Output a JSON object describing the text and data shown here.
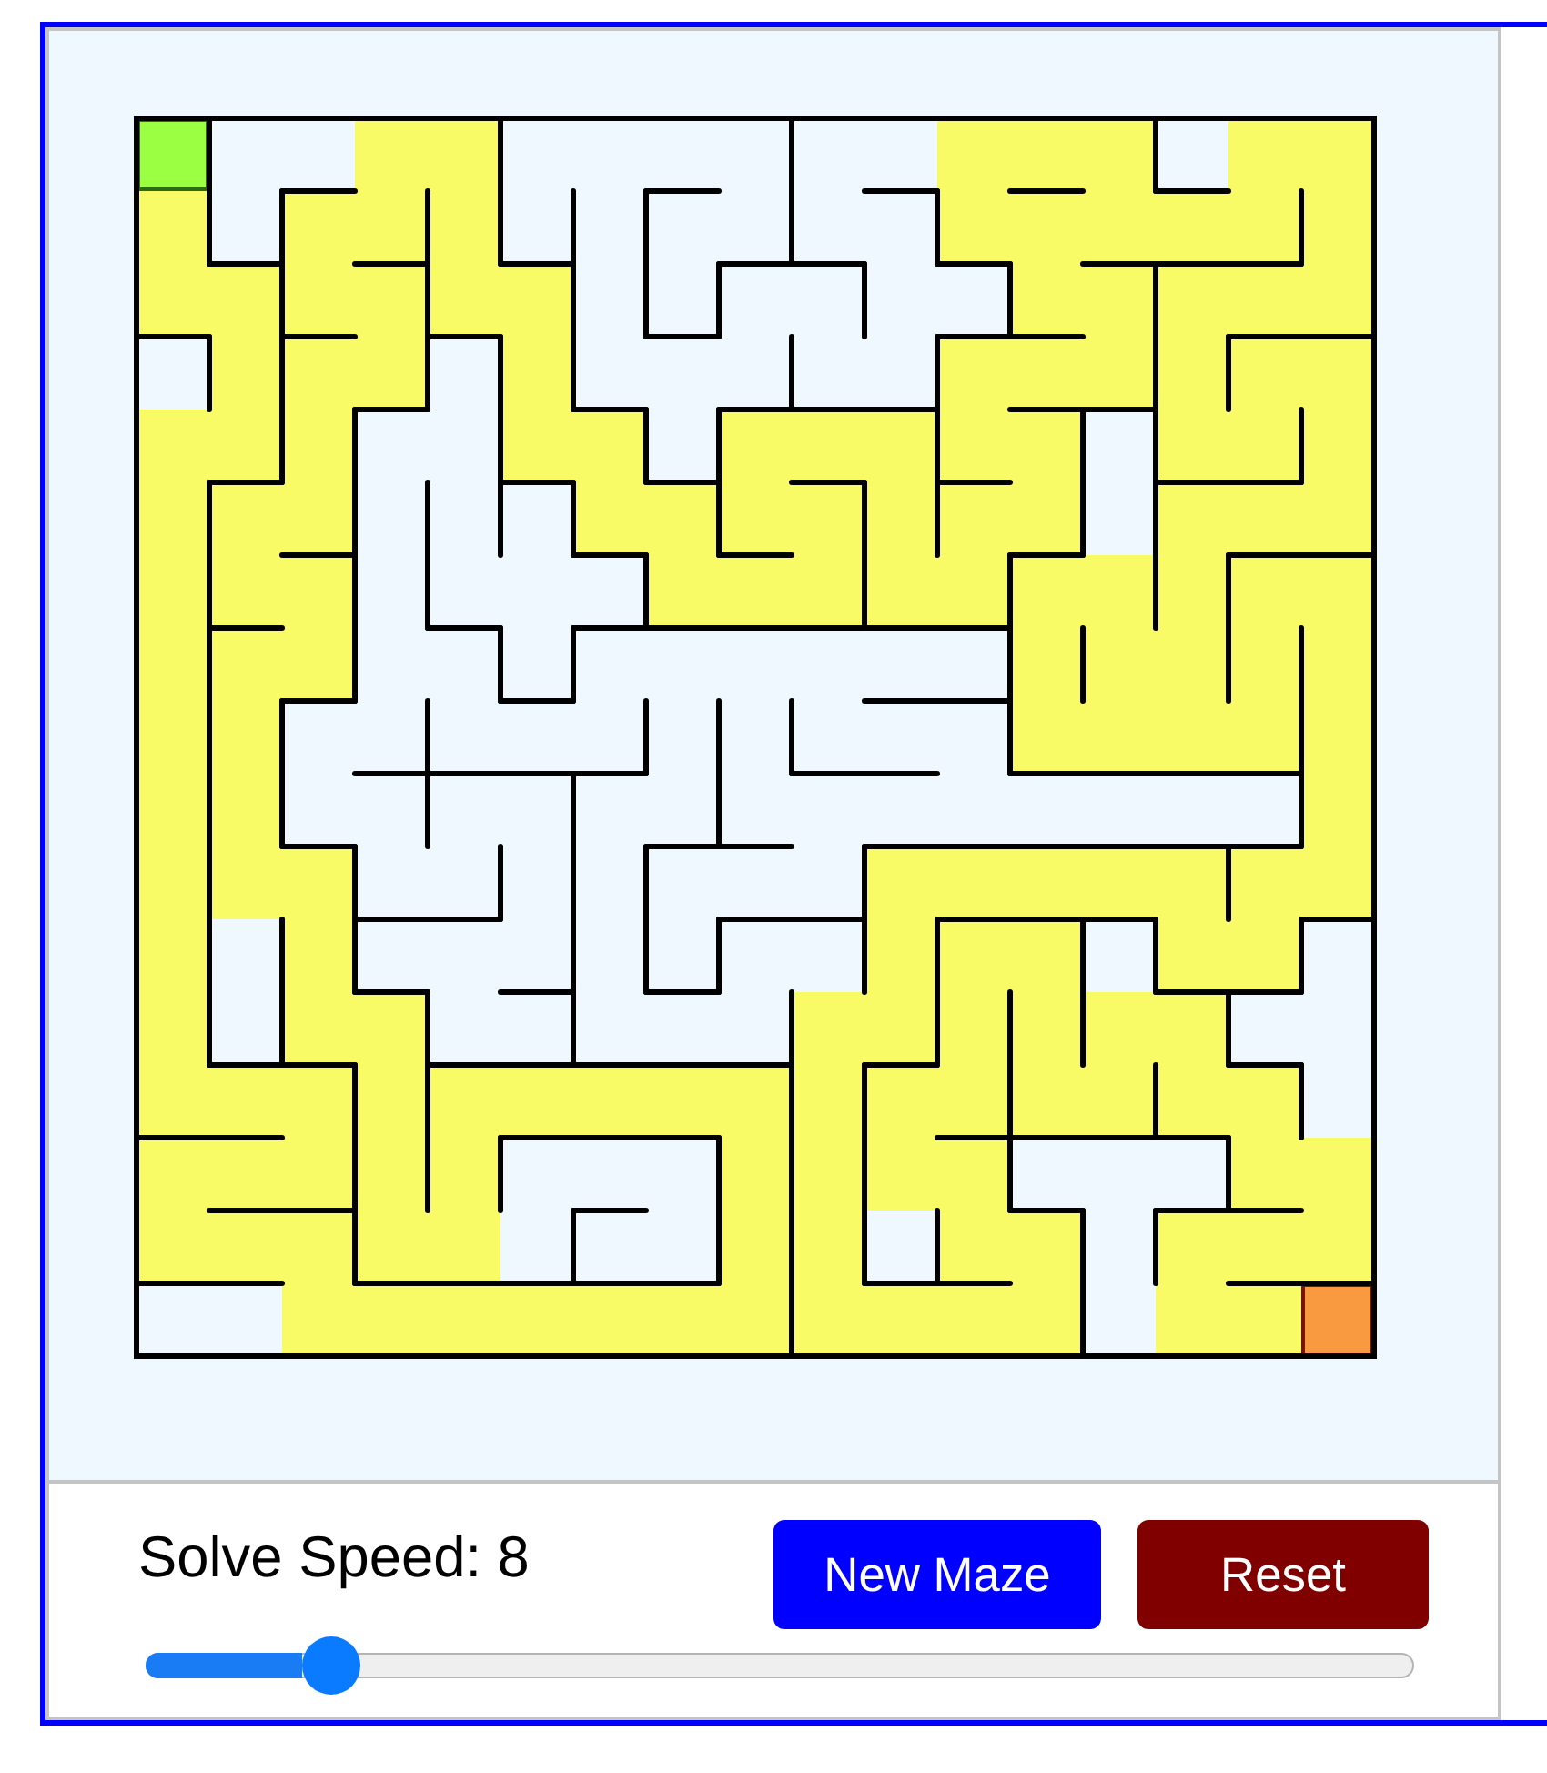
{
  "maze": {
    "cells": [
      [
        {
          "kind": "start",
          "right_wall": true
        },
        {
          "kind": "open"
        },
        {
          "kind": "open",
          "bottom_wall": true
        },
        {
          "kind": "path"
        },
        {
          "kind": "path",
          "right_wall": true
        },
        {
          "kind": "open"
        },
        {
          "kind": "open"
        },
        {
          "kind": "open",
          "bottom_wall": true
        },
        {
          "kind": "open",
          "right_wall": true
        },
        {
          "kind": "open"
        },
        {
          "kind": "open",
          "bottom_wall": true
        },
        {
          "kind": "path"
        },
        {
          "kind": "path",
          "bottom_wall": true
        },
        {
          "kind": "path",
          "right_wall": true
        },
        {
          "kind": "open",
          "bottom_wall": true
        },
        {
          "kind": "path"
        },
        {
          "kind": "path"
        }
      ],
      [
        {
          "kind": "path",
          "right_wall": true
        },
        {
          "kind": "open",
          "right_wall": true,
          "bottom_wall": true
        },
        {
          "kind": "path"
        },
        {
          "kind": "path",
          "right_wall": true,
          "bottom_wall": true
        },
        {
          "kind": "path",
          "right_wall": true
        },
        {
          "kind": "open",
          "right_wall": true,
          "bottom_wall": true
        },
        {
          "kind": "open",
          "right_wall": true
        },
        {
          "kind": "open"
        },
        {
          "kind": "open",
          "right_wall": true,
          "bottom_wall": true
        },
        {
          "kind": "open",
          "bottom_wall": true
        },
        {
          "kind": "open",
          "right_wall": true
        },
        {
          "kind": "path",
          "bottom_wall": true
        },
        {
          "kind": "path"
        },
        {
          "kind": "path",
          "bottom_wall": true
        },
        {
          "kind": "path",
          "bottom_wall": true
        },
        {
          "kind": "path",
          "right_wall": true,
          "bottom_wall": true
        },
        {
          "kind": "path"
        }
      ],
      [
        {
          "kind": "path",
          "bottom_wall": true
        },
        {
          "kind": "path",
          "right_wall": true
        },
        {
          "kind": "path",
          "bottom_wall": true
        },
        {
          "kind": "path",
          "right_wall": true
        },
        {
          "kind": "path",
          "bottom_wall": true
        },
        {
          "kind": "path",
          "right_wall": true
        },
        {
          "kind": "open",
          "right_wall": true
        },
        {
          "kind": "open",
          "right_wall": true,
          "bottom_wall": true
        },
        {
          "kind": "open"
        },
        {
          "kind": "open",
          "right_wall": true
        },
        {
          "kind": "open"
        },
        {
          "kind": "open",
          "right_wall": true,
          "bottom_wall": true
        },
        {
          "kind": "path",
          "bottom_wall": true
        },
        {
          "kind": "path",
          "right_wall": true
        },
        {
          "kind": "path"
        },
        {
          "kind": "path",
          "bottom_wall": true
        },
        {
          "kind": "path",
          "bottom_wall": true
        }
      ],
      [
        {
          "kind": "open",
          "right_wall": true
        },
        {
          "kind": "path",
          "right_wall": true
        },
        {
          "kind": "path"
        },
        {
          "kind": "path",
          "right_wall": true,
          "bottom_wall": true
        },
        {
          "kind": "open",
          "right_wall": true
        },
        {
          "kind": "path",
          "right_wall": true
        },
        {
          "kind": "open",
          "bottom_wall": true
        },
        {
          "kind": "open"
        },
        {
          "kind": "open",
          "right_wall": true,
          "bottom_wall": true
        },
        {
          "kind": "open",
          "bottom_wall": true
        },
        {
          "kind": "open",
          "right_wall": true,
          "bottom_wall": true
        },
        {
          "kind": "path"
        },
        {
          "kind": "path",
          "bottom_wall": true
        },
        {
          "kind": "path",
          "right_wall": true,
          "bottom_wall": true
        },
        {
          "kind": "path",
          "right_wall": true
        },
        {
          "kind": "path"
        },
        {
          "kind": "path"
        }
      ],
      [
        {
          "kind": "path"
        },
        {
          "kind": "path",
          "right_wall": true,
          "bottom_wall": true
        },
        {
          "kind": "path",
          "right_wall": true
        },
        {
          "kind": "open"
        },
        {
          "kind": "open",
          "right_wall": true
        },
        {
          "kind": "path",
          "bottom_wall": true
        },
        {
          "kind": "path",
          "right_wall": true
        },
        {
          "kind": "open",
          "right_wall": true,
          "bottom_wall": true
        },
        {
          "kind": "path"
        },
        {
          "kind": "path",
          "bottom_wall": true
        },
        {
          "kind": "path",
          "right_wall": true
        },
        {
          "kind": "path",
          "bottom_wall": true
        },
        {
          "kind": "path",
          "right_wall": true
        },
        {
          "kind": "open",
          "right_wall": true
        },
        {
          "kind": "path",
          "bottom_wall": true
        },
        {
          "kind": "path",
          "right_wall": true,
          "bottom_wall": true
        },
        {
          "kind": "path"
        }
      ],
      [
        {
          "kind": "path",
          "right_wall": true
        },
        {
          "kind": "path"
        },
        {
          "kind": "path",
          "right_wall": true,
          "bottom_wall": true
        },
        {
          "kind": "open",
          "right_wall": true
        },
        {
          "kind": "open",
          "right_wall": true
        },
        {
          "kind": "open",
          "right_wall": true
        },
        {
          "kind": "path",
          "bottom_wall": true
        },
        {
          "kind": "path",
          "right_wall": true
        },
        {
          "kind": "path",
          "bottom_wall": true
        },
        {
          "kind": "path",
          "right_wall": true
        },
        {
          "kind": "path",
          "right_wall": true
        },
        {
          "kind": "path"
        },
        {
          "kind": "path",
          "right_wall": true,
          "bottom_wall": true
        },
        {
          "kind": "open",
          "right_wall": true
        },
        {
          "kind": "path"
        },
        {
          "kind": "path",
          "bottom_wall": true
        },
        {
          "kind": "path",
          "bottom_wall": true
        }
      ],
      [
        {
          "kind": "path",
          "right_wall": true
        },
        {
          "kind": "path",
          "bottom_wall": true
        },
        {
          "kind": "path",
          "right_wall": true
        },
        {
          "kind": "open",
          "right_wall": true
        },
        {
          "kind": "open",
          "bottom_wall": true
        },
        {
          "kind": "open"
        },
        {
          "kind": "open",
          "right_wall": true,
          "bottom_wall": true
        },
        {
          "kind": "path",
          "bottom_wall": true
        },
        {
          "kind": "path",
          "bottom_wall": true
        },
        {
          "kind": "path",
          "right_wall": true,
          "bottom_wall": true
        },
        {
          "kind": "path",
          "bottom_wall": true
        },
        {
          "kind": "path",
          "right_wall": true,
          "bottom_wall": true
        },
        {
          "kind": "path"
        },
        {
          "kind": "path",
          "right_wall": true
        },
        {
          "kind": "path",
          "right_wall": true
        },
        {
          "kind": "path"
        },
        {
          "kind": "path"
        }
      ],
      [
        {
          "kind": "path",
          "right_wall": true
        },
        {
          "kind": "path"
        },
        {
          "kind": "path",
          "right_wall": true,
          "bottom_wall": true
        },
        {
          "kind": "open"
        },
        {
          "kind": "open",
          "right_wall": true
        },
        {
          "kind": "open",
          "right_wall": true,
          "bottom_wall": true
        },
        {
          "kind": "open"
        },
        {
          "kind": "open"
        },
        {
          "kind": "open"
        },
        {
          "kind": "open"
        },
        {
          "kind": "open",
          "bottom_wall": true
        },
        {
          "kind": "open",
          "right_wall": true,
          "bottom_wall": true
        },
        {
          "kind": "path",
          "right_wall": true
        },
        {
          "kind": "path"
        },
        {
          "kind": "path",
          "right_wall": true
        },
        {
          "kind": "path",
          "right_wall": true
        },
        {
          "kind": "path"
        }
      ],
      [
        {
          "kind": "path",
          "right_wall": true
        },
        {
          "kind": "path",
          "right_wall": true
        },
        {
          "kind": "open"
        },
        {
          "kind": "open",
          "right_wall": true,
          "bottom_wall": true
        },
        {
          "kind": "open",
          "bottom_wall": true
        },
        {
          "kind": "open",
          "bottom_wall": true
        },
        {
          "kind": "open",
          "right_wall": true,
          "bottom_wall": true
        },
        {
          "kind": "open",
          "right_wall": true
        },
        {
          "kind": "open",
          "right_wall": true
        },
        {
          "kind": "open",
          "bottom_wall": true
        },
        {
          "kind": "open",
          "bottom_wall": true
        },
        {
          "kind": "open",
          "right_wall": true
        },
        {
          "kind": "path",
          "bottom_wall": true
        },
        {
          "kind": "path",
          "bottom_wall": true
        },
        {
          "kind": "path",
          "bottom_wall": true
        },
        {
          "kind": "path",
          "right_wall": true,
          "bottom_wall": true
        },
        {
          "kind": "path"
        }
      ],
      [
        {
          "kind": "path",
          "right_wall": true
        },
        {
          "kind": "path",
          "right_wall": true
        },
        {
          "kind": "open",
          "bottom_wall": true
        },
        {
          "kind": "open",
          "right_wall": true
        },
        {
          "kind": "open"
        },
        {
          "kind": "open",
          "right_wall": true
        },
        {
          "kind": "open"
        },
        {
          "kind": "open",
          "right_wall": true,
          "bottom_wall": true
        },
        {
          "kind": "open",
          "bottom_wall": true
        },
        {
          "kind": "open"
        },
        {
          "kind": "open",
          "bottom_wall": true
        },
        {
          "kind": "open",
          "bottom_wall": true
        },
        {
          "kind": "open",
          "bottom_wall": true
        },
        {
          "kind": "open",
          "bottom_wall": true
        },
        {
          "kind": "open",
          "bottom_wall": true
        },
        {
          "kind": "open",
          "right_wall": true,
          "bottom_wall": true
        },
        {
          "kind": "path"
        }
      ],
      [
        {
          "kind": "path",
          "right_wall": true
        },
        {
          "kind": "path"
        },
        {
          "kind": "path",
          "right_wall": true
        },
        {
          "kind": "open",
          "bottom_wall": true
        },
        {
          "kind": "open",
          "right_wall": true,
          "bottom_wall": true
        },
        {
          "kind": "open",
          "right_wall": true
        },
        {
          "kind": "open",
          "right_wall": true
        },
        {
          "kind": "open"
        },
        {
          "kind": "open",
          "bottom_wall": true
        },
        {
          "kind": "open",
          "right_wall": true,
          "bottom_wall": true
        },
        {
          "kind": "path"
        },
        {
          "kind": "path",
          "bottom_wall": true
        },
        {
          "kind": "path",
          "bottom_wall": true
        },
        {
          "kind": "path",
          "bottom_wall": true
        },
        {
          "kind": "path",
          "right_wall": true
        },
        {
          "kind": "path"
        },
        {
          "kind": "path",
          "bottom_wall": true
        }
      ],
      [
        {
          "kind": "path",
          "right_wall": true
        },
        {
          "kind": "open",
          "right_wall": true
        },
        {
          "kind": "path",
          "right_wall": true
        },
        {
          "kind": "open",
          "bottom_wall": true
        },
        {
          "kind": "open"
        },
        {
          "kind": "open",
          "right_wall": true,
          "bottom_wall": true
        },
        {
          "kind": "open",
          "right_wall": true
        },
        {
          "kind": "open",
          "right_wall": true,
          "bottom_wall": true
        },
        {
          "kind": "open"
        },
        {
          "kind": "open",
          "right_wall": true
        },
        {
          "kind": "path",
          "right_wall": true
        },
        {
          "kind": "path"
        },
        {
          "kind": "path",
          "right_wall": true
        },
        {
          "kind": "open",
          "right_wall": true
        },
        {
          "kind": "path",
          "bottom_wall": true
        },
        {
          "kind": "path",
          "right_wall": true,
          "bottom_wall": true
        },
        {
          "kind": "open"
        }
      ],
      [
        {
          "kind": "path",
          "right_wall": true
        },
        {
          "kind": "open",
          "right_wall": true,
          "bottom_wall": true
        },
        {
          "kind": "path",
          "bottom_wall": true
        },
        {
          "kind": "path",
          "right_wall": true
        },
        {
          "kind": "open",
          "bottom_wall": true
        },
        {
          "kind": "open",
          "right_wall": true,
          "bottom_wall": true
        },
        {
          "kind": "open",
          "bottom_wall": true
        },
        {
          "kind": "open",
          "bottom_wall": true
        },
        {
          "kind": "open",
          "right_wall": true,
          "bottom_wall": true
        },
        {
          "kind": "path"
        },
        {
          "kind": "path",
          "right_wall": true,
          "bottom_wall": true
        },
        {
          "kind": "path",
          "right_wall": true
        },
        {
          "kind": "path",
          "right_wall": true
        },
        {
          "kind": "path"
        },
        {
          "kind": "path",
          "right_wall": true
        },
        {
          "kind": "open",
          "bottom_wall": true
        },
        {
          "kind": "open"
        }
      ],
      [
        {
          "kind": "path",
          "bottom_wall": true
        },
        {
          "kind": "path",
          "bottom_wall": true
        },
        {
          "kind": "path",
          "right_wall": true
        },
        {
          "kind": "path",
          "right_wall": true
        },
        {
          "kind": "path"
        },
        {
          "kind": "path",
          "bottom_wall": true
        },
        {
          "kind": "path",
          "bottom_wall": true
        },
        {
          "kind": "path",
          "bottom_wall": true
        },
        {
          "kind": "path",
          "right_wall": true
        },
        {
          "kind": "path",
          "right_wall": true
        },
        {
          "kind": "path"
        },
        {
          "kind": "path",
          "right_wall": true,
          "bottom_wall": true
        },
        {
          "kind": "path",
          "bottom_wall": true
        },
        {
          "kind": "path",
          "right_wall": true,
          "bottom_wall": true
        },
        {
          "kind": "path",
          "bottom_wall": true
        },
        {
          "kind": "path",
          "right_wall": true
        },
        {
          "kind": "open"
        }
      ],
      [
        {
          "kind": "path"
        },
        {
          "kind": "path",
          "bottom_wall": true
        },
        {
          "kind": "path",
          "right_wall": true,
          "bottom_wall": true
        },
        {
          "kind": "path",
          "right_wall": true
        },
        {
          "kind": "path",
          "right_wall": true
        },
        {
          "kind": "open"
        },
        {
          "kind": "open",
          "bottom_wall": true
        },
        {
          "kind": "open",
          "right_wall": true
        },
        {
          "kind": "path",
          "right_wall": true
        },
        {
          "kind": "path",
          "right_wall": true
        },
        {
          "kind": "path"
        },
        {
          "kind": "path",
          "right_wall": true
        },
        {
          "kind": "open",
          "bottom_wall": true
        },
        {
          "kind": "open"
        },
        {
          "kind": "open",
          "right_wall": true,
          "bottom_wall": true
        },
        {
          "kind": "path",
          "bottom_wall": true
        },
        {
          "kind": "path"
        }
      ],
      [
        {
          "kind": "path",
          "bottom_wall": true
        },
        {
          "kind": "path",
          "bottom_wall": true
        },
        {
          "kind": "path",
          "right_wall": true
        },
        {
          "kind": "path",
          "bottom_wall": true
        },
        {
          "kind": "path",
          "bottom_wall": true
        },
        {
          "kind": "open",
          "right_wall": true,
          "bottom_wall": true
        },
        {
          "kind": "open",
          "bottom_wall": true
        },
        {
          "kind": "open",
          "right_wall": true,
          "bottom_wall": true
        },
        {
          "kind": "path",
          "right_wall": true
        },
        {
          "kind": "path",
          "right_wall": true
        },
        {
          "kind": "open",
          "right_wall": true,
          "bottom_wall": true
        },
        {
          "kind": "path",
          "bottom_wall": true
        },
        {
          "kind": "path",
          "right_wall": true
        },
        {
          "kind": "open",
          "right_wall": true
        },
        {
          "kind": "path"
        },
        {
          "kind": "path",
          "bottom_wall": true
        },
        {
          "kind": "path",
          "bottom_wall": true
        }
      ],
      [
        {
          "kind": "open"
        },
        {
          "kind": "open"
        },
        {
          "kind": "path"
        },
        {
          "kind": "path"
        },
        {
          "kind": "path"
        },
        {
          "kind": "path"
        },
        {
          "kind": "path"
        },
        {
          "kind": "path"
        },
        {
          "kind": "path",
          "right_wall": true
        },
        {
          "kind": "path"
        },
        {
          "kind": "path"
        },
        {
          "kind": "path"
        },
        {
          "kind": "path",
          "right_wall": true
        },
        {
          "kind": "open"
        },
        {
          "kind": "path"
        },
        {
          "kind": "path"
        },
        {
          "kind": "end"
        }
      ]
    ]
  },
  "controls": {
    "speed_label": "Solve Speed: 8",
    "buttons": [
      {
        "label": "New Maze",
        "kind": "generate"
      },
      {
        "label": "Reset",
        "kind": "reset"
      }
    ],
    "speed_slider": {
      "level": 0.13
    }
  }
}
